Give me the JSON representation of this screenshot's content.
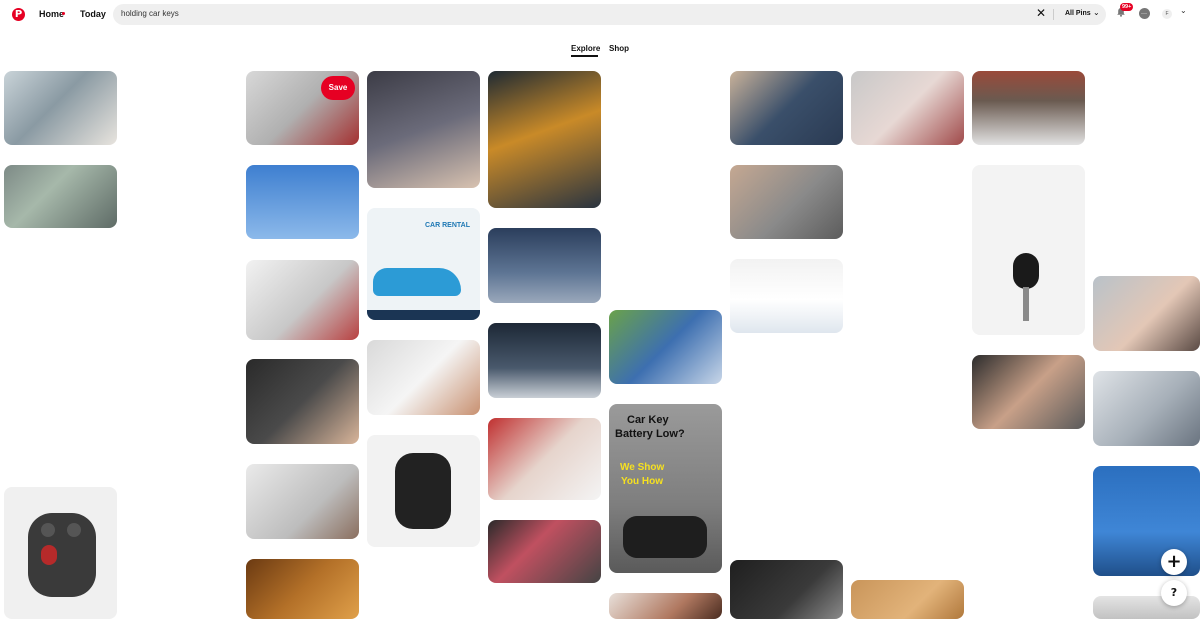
{
  "nav": {
    "logo": "P",
    "home": "Home",
    "today": "Today"
  },
  "search": {
    "value": "holding car keys",
    "filter": "All Pins"
  },
  "notifications": {
    "badge": "99+"
  },
  "account": {
    "initial": "F"
  },
  "tabs": [
    {
      "label": "Explore",
      "active": true
    },
    {
      "label": "Shop",
      "active": false
    }
  ],
  "save_label": "Save",
  "pin_texts": {
    "car_rental": "CAR RENTAL",
    "battery_line1": "Car Key",
    "battery_line2": "Battery Low?",
    "we_show": "We Show",
    "you_how": "You How"
  },
  "fab": {
    "add": "+",
    "help": "?"
  },
  "colors": {
    "accent": "#e60023"
  }
}
